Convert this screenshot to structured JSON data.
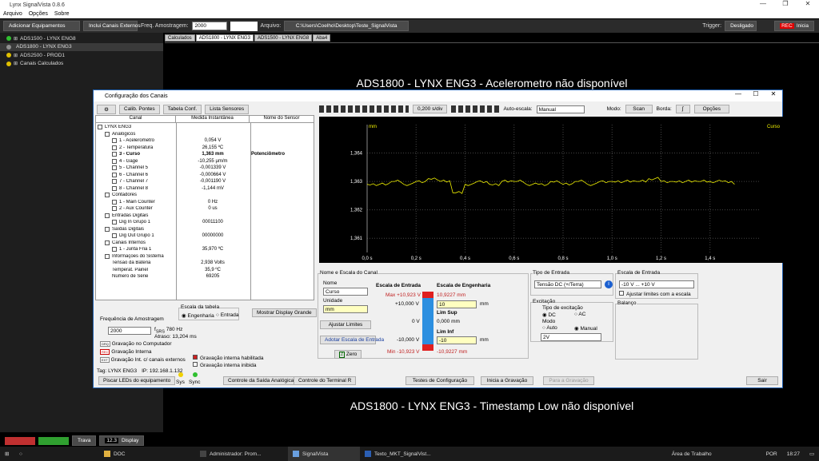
{
  "window": {
    "title": "Lynx SignalVista 0.8.6",
    "menu": [
      "Arquivo",
      "Opções",
      "Sobre"
    ]
  },
  "toolbar": {
    "add_equipment": "Adicionar Equipamentos",
    "include_external": "Inclui Canais Externos",
    "freq_label": "Freq. Amostragem:",
    "freq_value": "2000",
    "file_label": "Arquivo:",
    "file_path": "C:\\Users\\Coelho\\Desktop\\Teste_SignalVista",
    "trigger_label": "Trigger:",
    "trigger_value": "Desligado",
    "start_label": "Inicia",
    "rec_label": "REC"
  },
  "left_tree": {
    "items": [
      {
        "label": "ADS1500 - LYNX ENG8",
        "color": "#30c030"
      },
      {
        "label": "ADS1800 - LYNX ENG3",
        "color": "#909090"
      },
      {
        "label": "ADS2500 - PROD1",
        "color": "#e0c000"
      },
      {
        "label": "Canais Calculados",
        "color": "#e0c000"
      }
    ]
  },
  "tabs": [
    "Calculados",
    "ADS1800 - LYNX ENG3",
    "ADS1500 - LYNX ENG8",
    "Aba4"
  ],
  "messages": {
    "top": "ADS1800 - LYNX ENG3 - Acelerometro  não disponível",
    "bottom": "ADS1800 - LYNX ENG3 - Timestamp Low  não disponível"
  },
  "bottom_left": {
    "trava": "Trava",
    "display_value": "12.3",
    "display_label": "Display"
  },
  "dialog": {
    "title": "Configuração dos Canais",
    "buttons": {
      "calib": "Calib. Pontes",
      "table": "Tabela Conf.",
      "list": "Lista Sensores"
    },
    "columns": [
      "Canal",
      "Medida Instantânea",
      "Nome do Sensor"
    ],
    "channels": [
      {
        "label": "LYNX ENG3",
        "value": "",
        "sensor": "",
        "level": 0
      },
      {
        "label": "Analógicos",
        "value": "",
        "sensor": "",
        "level": 1
      },
      {
        "label": "1 - Acelerometro",
        "value": "0,054 V",
        "sensor": "",
        "level": 2
      },
      {
        "label": "2 - Temperatura",
        "value": "26,155 ºC",
        "sensor": "",
        "level": 2
      },
      {
        "label": "3 - Curso",
        "value": "1,363 mm",
        "sensor": "Potenciômetro",
        "level": 2,
        "bold": true
      },
      {
        "label": "4 - Gage",
        "value": "-10,255 µm/m",
        "sensor": "",
        "level": 2
      },
      {
        "label": "5 - Channel 5",
        "value": "-0,001339 V",
        "sensor": "",
        "level": 2
      },
      {
        "label": "6 - Channel 6",
        "value": "-0,000664 V",
        "sensor": "",
        "level": 2
      },
      {
        "label": "7 - Channel 7",
        "value": "-0,001190 V",
        "sensor": "",
        "level": 2
      },
      {
        "label": "8 - Channel 8",
        "value": "-1,144 mV",
        "sensor": "",
        "level": 2
      },
      {
        "label": "Contadores",
        "value": "",
        "sensor": "",
        "level": 1
      },
      {
        "label": "1 - Main Counter",
        "value": "0 Hz",
        "sensor": "",
        "level": 2
      },
      {
        "label": "2 - Aux Counter",
        "value": "0 us",
        "sensor": "",
        "level": 2
      },
      {
        "label": "Entradas Digitais",
        "value": "",
        "sensor": "",
        "level": 1
      },
      {
        "label": "Dig In Grupo 1",
        "value": "00011100",
        "sensor": "",
        "level": 2
      },
      {
        "label": "Saídas Digitais",
        "value": "",
        "sensor": "",
        "level": 1
      },
      {
        "label": "Dig Out Grupo 1",
        "value": "00000000",
        "sensor": "",
        "level": 2
      },
      {
        "label": "Canais Internos",
        "value": "",
        "sensor": "",
        "level": 1
      },
      {
        "label": "1 - Junta Fria 1",
        "value": "35,970 ºC",
        "sensor": "",
        "level": 2
      },
      {
        "label": "Informações do Sistema",
        "value": "",
        "sensor": "",
        "level": 1
      },
      {
        "label": "Tensão da Bateria",
        "value": "2,938 Volts",
        "sensor": "",
        "level": 2
      },
      {
        "label": "Temperat. Painel",
        "value": "35,9 ºC",
        "sensor": "",
        "level": 2
      },
      {
        "label": "Número de Série",
        "value": "69205",
        "sensor": "",
        "level": 2
      }
    ],
    "scale_table": {
      "title": "Escala da tabela",
      "engineering": "Engenharia",
      "input": "Entrada"
    },
    "show_display": "Mostrar Display Grande",
    "sampling": {
      "title": "Frequência de Amostragem",
      "value": "2000",
      "fs": "f",
      "fs_sub": "SRS",
      "fs_val": "780 Hz",
      "delay": "Atraso: 13,204 ms"
    },
    "recording": {
      "pc": "Gravação no Computador",
      "internal": "Gravação Interna",
      "ext": "Gravação Int. c/ canais externos",
      "enabled": "Gravação interna habilitada",
      "inhibited": "Gravação interna inibida",
      "tag_drq": "DRQ",
      "tag_rec": "REC",
      "tag_ext": "EXT"
    },
    "status": {
      "tag": "Tag: LYNX ENG3",
      "ip": "IP: 192.168.1.132",
      "sys": "Sys",
      "sync": "Sync"
    },
    "bottom_buttons": {
      "blink": "Piscar LEDs do equipamento",
      "analog_out": "Controle da Saída Analógica",
      "terminal": "Controle do Terminal R",
      "tests": "Testes de Configuração",
      "start_rec": "Inicia a Gravação",
      "stop_rec": "Para a Gravação",
      "exit": "Sair"
    },
    "plot_toolbar": {
      "time_div": "0,200 s/div",
      "autoscale_label": "Auto-escala:",
      "autoscale_value": "Manual",
      "mode_label": "Modo:",
      "mode_value": "Scan",
      "border_label": "Borda:",
      "options": "Opções"
    },
    "name_scale": {
      "title": "Nome e Escala do Canal",
      "name_label": "Nome",
      "name_value": "Curso",
      "unit_label": "Unidade",
      "unit_value": "mm",
      "adjust": "Ajustar Limites",
      "adopt": "Adotar Escala de Entrada",
      "zero": "Zero",
      "input_scale": "Escala de Entrada",
      "eng_scale": "Escala de Engenharia",
      "max_in": "Max +10,923 V",
      "max_eng": "10,9227 mm",
      "in_high": "+10,000 V",
      "eng_high": "10",
      "unit_mm": "mm",
      "lim_sup": "Lim Sup",
      "in_zero": "0 V",
      "eng_zero": "0,000 mm",
      "lim_inf": "Lim Inf",
      "in_low": "-10,000 V",
      "eng_low": "-10",
      "min_in": "Min -10,923 V",
      "min_eng": "-10,9227 mm"
    },
    "input_type": {
      "title": "Tipo de Entrada",
      "value": "Tensão DC (+/Terra)"
    },
    "excitation": {
      "title": "Excitação",
      "type_title": "Tipo de excitação",
      "dc": "DC",
      "ac": "AC",
      "mode_title": "Modo",
      "auto": "Auto",
      "manual": "Manual",
      "value": "2V"
    },
    "input_range": {
      "title": "Escala de Entrada",
      "value": "-10 V ... +10 V",
      "adjust": "Ajustar limites com a escala"
    },
    "balance": {
      "title": "Balanço"
    }
  },
  "chart_data": {
    "type": "line",
    "yunit": "mm",
    "ylim": [
      1.3605,
      1.365
    ],
    "yticks": [
      "1,364",
      "1,363",
      "1,362",
      "1,361"
    ],
    "xlim": [
      0,
      1.6
    ],
    "xticks": [
      "0,0 s",
      "0,2 s",
      "0,4 s",
      "0,6 s",
      "0,8 s",
      "1,0 s",
      "1,2 s",
      "1,4 s"
    ],
    "series": [
      {
        "name": "Curso",
        "color": "#f0f000",
        "x": [
          0.0,
          0.05,
          0.1,
          0.15,
          0.2,
          0.25,
          0.3,
          0.35,
          0.4,
          0.45,
          0.5,
          0.55,
          0.6,
          0.65,
          0.7,
          0.75,
          0.8,
          0.85,
          0.9,
          0.95,
          1.0,
          1.05,
          1.1,
          1.15,
          1.2,
          1.25,
          1.3,
          1.35,
          1.4,
          1.45,
          1.5
        ],
        "y": [
          1.3629,
          1.3629,
          1.363,
          1.3629,
          1.363,
          1.3631,
          1.363,
          1.3626,
          1.3629,
          1.363,
          1.3629,
          1.363,
          1.363,
          1.3629,
          1.3629,
          1.363,
          1.3629,
          1.363,
          1.3629,
          1.363,
          1.363,
          1.363,
          1.363,
          1.3631,
          1.363,
          1.363,
          1.363,
          1.363,
          1.363,
          1.363,
          1.3629
        ]
      }
    ]
  },
  "taskbar": {
    "items": [
      "DOC",
      "Administrador: Prom...",
      "SignalVista",
      "Texto_MKT_SignalVist..."
    ],
    "work_area": "Área de Trabalho",
    "lang": "POR",
    "clock": "18:27"
  }
}
